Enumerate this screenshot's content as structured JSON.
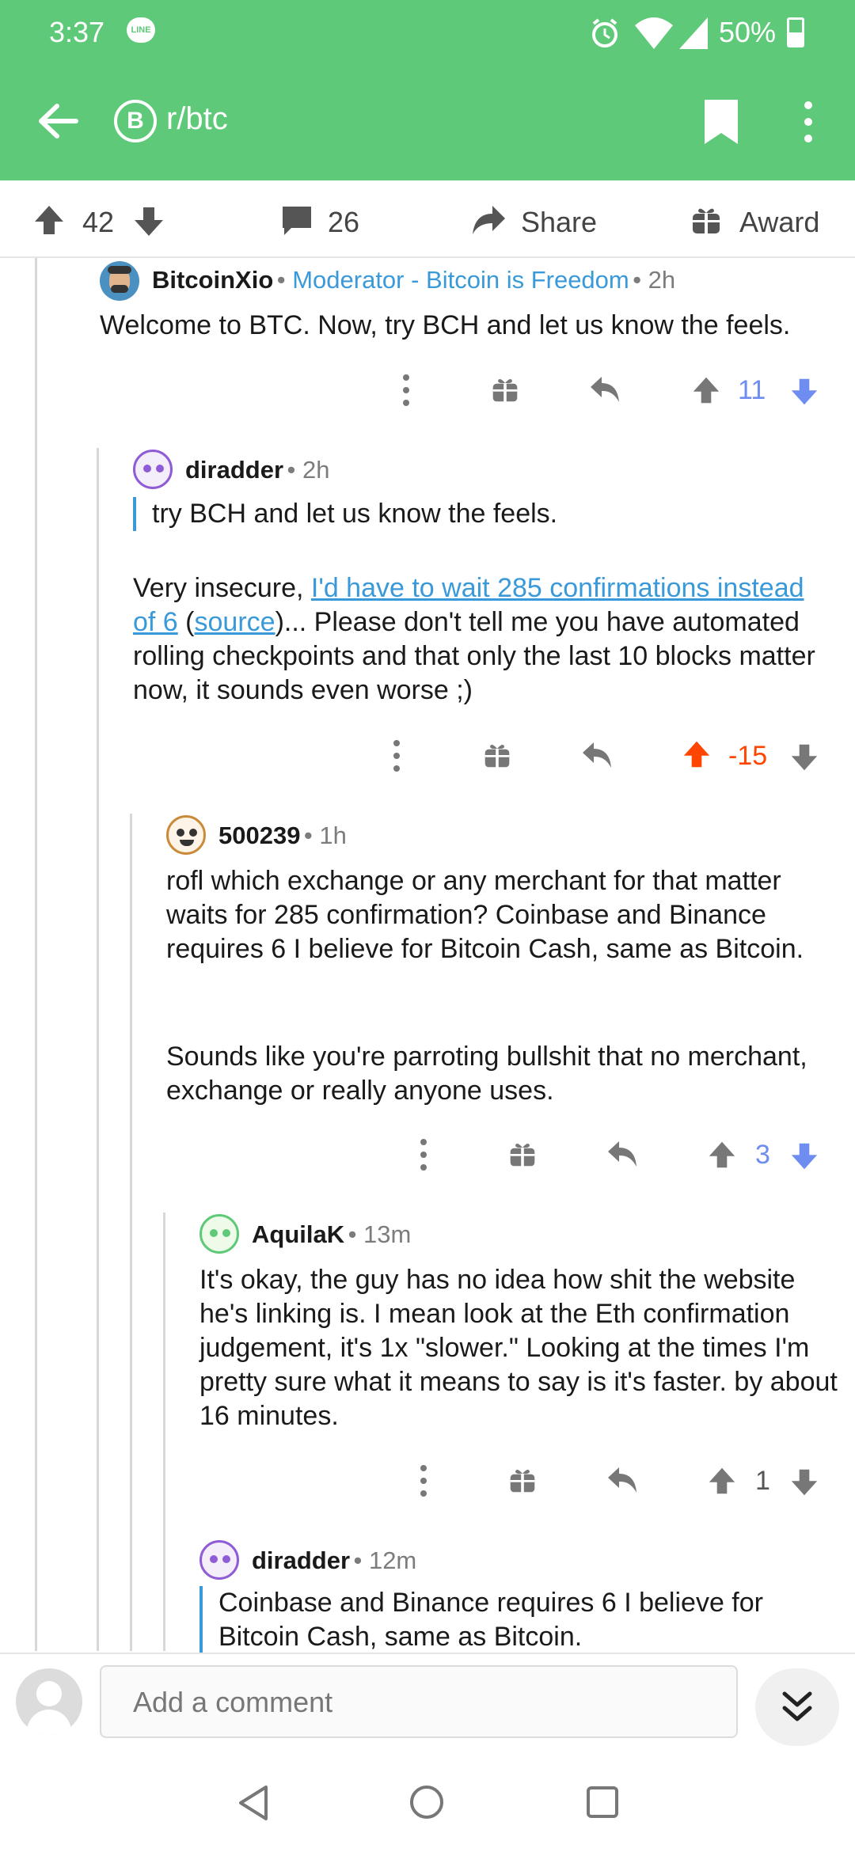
{
  "status_bar": {
    "time": "3:37",
    "line_badge": "LINE",
    "battery": "50%"
  },
  "header": {
    "subreddit": "r/btc",
    "bitcoin_symbol": "B"
  },
  "post_actions": {
    "score": "42",
    "comments": "26",
    "share": "Share",
    "award": "Award"
  },
  "comments": [
    {
      "author": "BitcoinXio",
      "flair": "Moderator - Bitcoin is Freedom",
      "time": "2h",
      "body": "Welcome to BTC. Now, try BCH and let us know the feels.",
      "score": "11",
      "vote": "none"
    },
    {
      "author": "diradder",
      "time": "2h",
      "quote": "try BCH and let us know the feels.",
      "body_prefix": "Very insecure, ",
      "link1": "I'd have to wait 285 confirmations instead of 6",
      "body_mid": " (",
      "link2": "source",
      "body_suffix": ")... Please don't tell me you have automated rolling checkpoints and that only the last 10 blocks matter now, it sounds even worse ;)",
      "score": "-15",
      "vote": "up"
    },
    {
      "author": "500239",
      "time": "1h",
      "para1": "rofl which exchange or any merchant for that matter waits for 285 confirmation? Coinbase and Binance requires 6 I believe for Bitcoin Cash, same as Bitcoin.",
      "para2": "Sounds like you're parroting bullshit that no merchant, exchange or really anyone uses.",
      "score": "3",
      "vote": "none"
    },
    {
      "author": "AquilaK",
      "time": "13m",
      "body": "It's okay, the guy has no idea how shit the website he's linking is.  I mean look at the Eth confirmation judgement, it's 1x \"slower.\"  Looking at the times I'm pretty sure what it means to say is it's faster. by about 16 minutes.",
      "score": "1",
      "vote": "none"
    },
    {
      "author": "diradder",
      "time": "12m",
      "quote": "Coinbase and Binance requires 6 I believe for Bitcoin Cash, same as Bitcoin."
    }
  ],
  "composer": {
    "placeholder": "Add a comment"
  },
  "colors": {
    "accent": "#5ec978",
    "link": "#3a9ad9",
    "upvote": "#ff4500",
    "vote_blue": "#6f8df0"
  }
}
